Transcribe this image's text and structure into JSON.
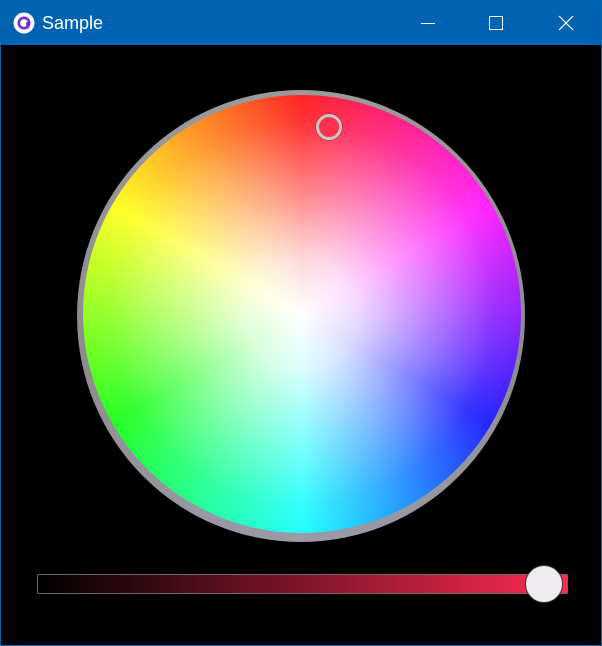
{
  "window": {
    "title": "Sample",
    "app_icon": "avalonia-logo-icon",
    "controls": {
      "minimize_icon": "minimize-icon",
      "maximize_icon": "maximize-icon",
      "close_icon": "close-icon"
    },
    "colors": {
      "titlebar": "#0063b1",
      "background": "#000000"
    }
  },
  "color_picker": {
    "selected_color": "#ff3050",
    "wheel": {
      "hue_order_clockwise_from_top": [
        "red",
        "magenta",
        "blue",
        "cyan",
        "green",
        "yellow"
      ]
    },
    "value_slider": {
      "gradient_start": "#000000",
      "gradient_end": "#ff2a55",
      "value": 1.0
    }
  }
}
